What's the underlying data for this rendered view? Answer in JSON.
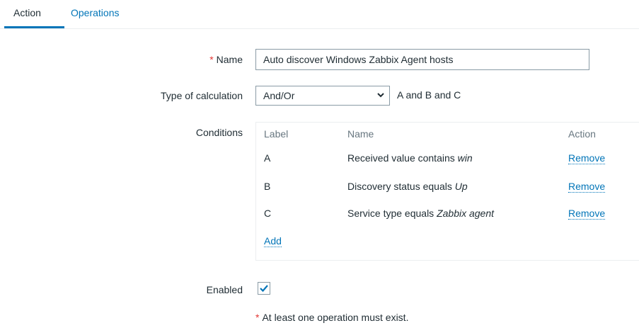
{
  "tabs": {
    "action": "Action",
    "operations": "Operations"
  },
  "form": {
    "required_mark": "*",
    "name_label": "Name",
    "name_value": "Auto discover Windows Zabbix Agent hosts",
    "calc_label": "Type of calculation",
    "calc_value": "And/Or",
    "calc_expression": "A and B and C",
    "conditions_label": "Conditions",
    "enabled_label": "Enabled",
    "enabled_checked": true,
    "note": "At least one operation must exist."
  },
  "conditions": {
    "headers": {
      "label": "Label",
      "name": "Name",
      "action": "Action"
    },
    "rows": [
      {
        "label": "A",
        "name_prefix": "Received value contains ",
        "name_value": "win",
        "action": "Remove"
      },
      {
        "label": "B",
        "name_prefix": "Discovery status equals ",
        "name_value": "Up",
        "action": "Remove"
      },
      {
        "label": "C",
        "name_prefix": "Service type equals ",
        "name_value": "Zabbix agent",
        "action": "Remove"
      }
    ],
    "add_label": "Add"
  },
  "colors": {
    "link": "#0275b8",
    "required": "#e33734",
    "text": "#1f2c33"
  }
}
